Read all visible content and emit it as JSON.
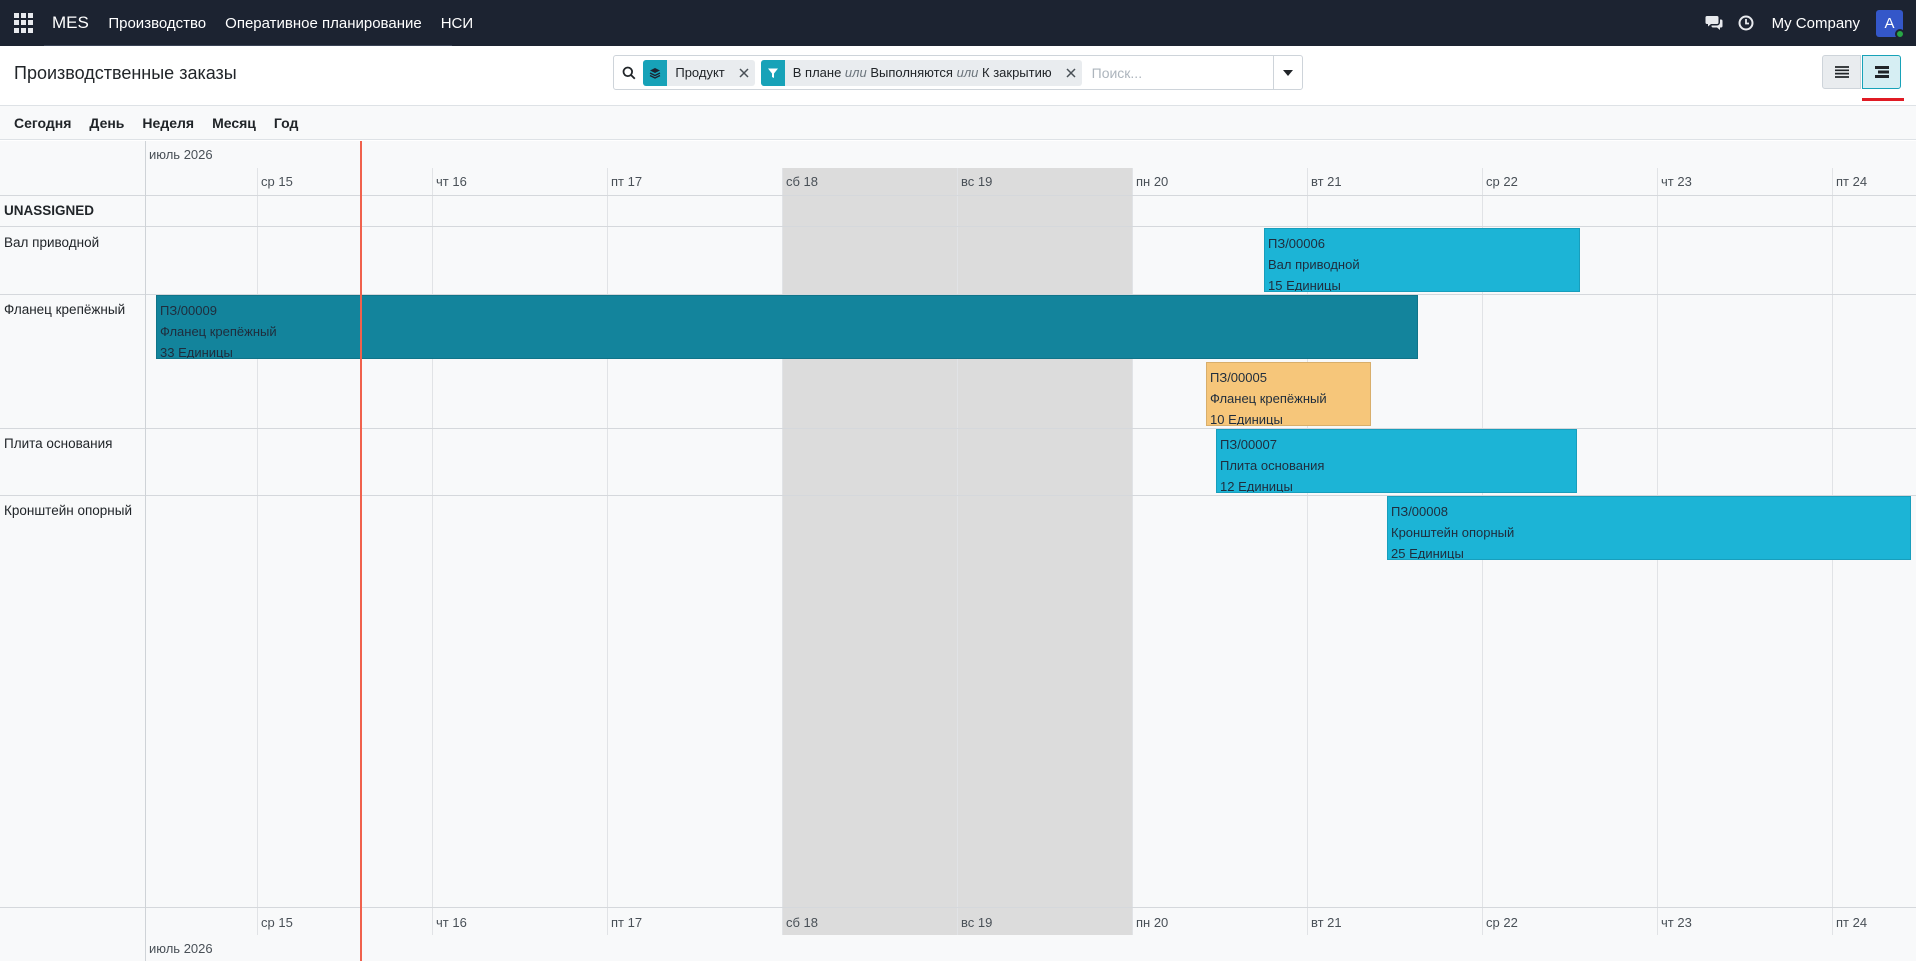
{
  "navbar": {
    "brand": "MES",
    "menu": [
      "Производство",
      "Оперативное планирование",
      "НСИ"
    ],
    "company": "My Company",
    "avatar_letter": "A"
  },
  "control_panel": {
    "title": "Производственные заказы",
    "facets": [
      {
        "icon": "layers-icon",
        "label": "Продукт"
      },
      {
        "icon": "filter-icon",
        "parts": [
          "В плане",
          "или",
          "Выполняются",
          "или",
          "К закрытию"
        ]
      }
    ],
    "search_placeholder": "Поиск...",
    "active_view": "gantt"
  },
  "scales": [
    "Сегодня",
    "День",
    "Неделя",
    "Месяц",
    "Год"
  ],
  "gantt": {
    "month": "июль 2026",
    "days": [
      "ср 15",
      "чт 16",
      "пт 17",
      "сб 18",
      "вс 19",
      "пн 20",
      "вт 21",
      "ср 22",
      "чт 23",
      "пт 24"
    ],
    "weekend_days": [
      "сб 18",
      "вс 19"
    ],
    "rows": [
      {
        "label": "UNASSIGNED",
        "bold": true
      },
      {
        "label": "Вал приводной"
      },
      {
        "label": "Фланец крепёжный"
      },
      {
        "label": "Плита основания"
      },
      {
        "label": "Кронштейн опорный"
      }
    ],
    "pills": [
      {
        "ref": "ПЗ/00006",
        "product": "Вал приводной",
        "qty": "15 Единицы",
        "color": "#1cb4d6"
      },
      {
        "ref": "ПЗ/00009",
        "product": "Фланец крепёжный",
        "qty": "33 Единицы",
        "color": "#13849c"
      },
      {
        "ref": "ПЗ/00005",
        "product": "Фланец крепёжный",
        "qty": "10 Единицы",
        "color": "#f6c67a"
      },
      {
        "ref": "ПЗ/00007",
        "product": "Плита основания",
        "qty": "12 Единицы",
        "color": "#1cb4d6"
      },
      {
        "ref": "ПЗ/00008",
        "product": "Кронштейн опорный",
        "qty": "25 Единицы",
        "color": "#1cb4d6"
      }
    ]
  }
}
